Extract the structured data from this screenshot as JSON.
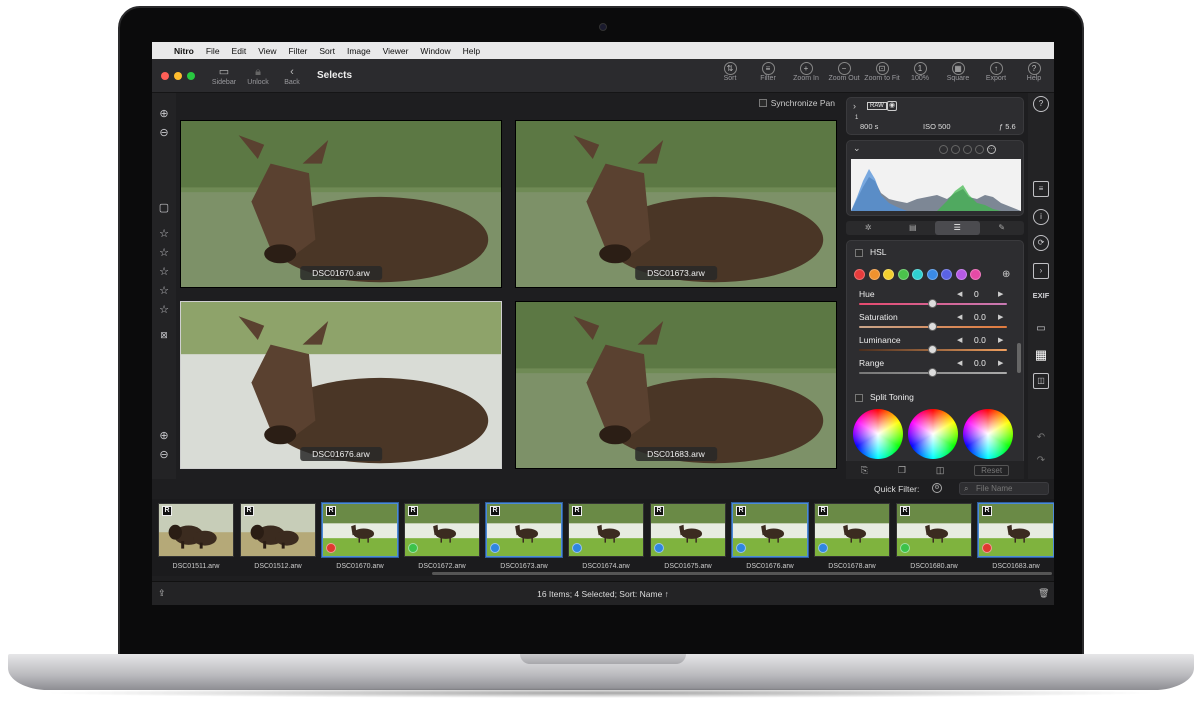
{
  "menu": {
    "app": "Nitro",
    "items": [
      "File",
      "Edit",
      "View",
      "Filter",
      "Sort",
      "Image",
      "Viewer",
      "Window",
      "Help"
    ]
  },
  "toolbar": {
    "sidebar_label": "Sidebar",
    "unlock_label": "Unlock",
    "back_label": "Back",
    "title": "Selects",
    "right": [
      {
        "label": "Sort",
        "icon": "sort-icon",
        "glyph": "⇅"
      },
      {
        "label": "Filter",
        "icon": "filter-icon",
        "glyph": "≡"
      },
      {
        "label": "Zoom In",
        "icon": "zoom-in-icon",
        "glyph": "+"
      },
      {
        "label": "Zoom Out",
        "icon": "zoom-out-icon",
        "glyph": "−"
      },
      {
        "label": "Zoom to Fit",
        "icon": "zoom-fit-icon",
        "glyph": "⊡"
      },
      {
        "label": "100%",
        "icon": "zoom-100-icon",
        "glyph": "1"
      },
      {
        "label": "Square",
        "icon": "square-grid-icon",
        "glyph": "▦"
      },
      {
        "label": "Export",
        "icon": "export-icon",
        "glyph": "↑"
      },
      {
        "label": "Help",
        "icon": "help-icon",
        "glyph": "?"
      }
    ]
  },
  "viewer": {
    "sync_label": "Synchronize Pan",
    "photos": [
      {
        "name": "DSC01670.arw",
        "selected": false
      },
      {
        "name": "DSC01673.arw",
        "selected": false
      },
      {
        "name": "DSC01676.arw",
        "selected": true
      },
      {
        "name": "DSC01683.arw",
        "selected": false
      }
    ]
  },
  "exif": {
    "badge_raw": "RAW",
    "shutter_num": "1",
    "shutter_den": "800 s",
    "iso": "ISO 500",
    "aperture": "ƒ 5.6"
  },
  "hsl": {
    "title": "HSL",
    "swatches": [
      "#e63c3c",
      "#f0922e",
      "#f2d02f",
      "#4bc24b",
      "#2fd0d0",
      "#3a8ae6",
      "#5a62e6",
      "#b65ae6",
      "#e64aa6"
    ],
    "sliders": [
      {
        "label": "Hue",
        "value": "0"
      },
      {
        "label": "Saturation",
        "value": "0.0"
      },
      {
        "label": "Luminance",
        "value": "0.0"
      },
      {
        "label": "Range",
        "value": "0.0"
      }
    ]
  },
  "split_toning": {
    "title": "Split Toning"
  },
  "panel_bottom": {
    "reset_label": "Reset"
  },
  "right_bar": {
    "exif_label": "EXIF"
  },
  "quick_filter": {
    "label": "Quick Filter:",
    "placeholder": "File Name"
  },
  "filmstrip": [
    {
      "name": "DSC01511.arw",
      "subject": "bison",
      "raw": true,
      "dot": null,
      "selected": false
    },
    {
      "name": "DSC01512.arw",
      "subject": "bison",
      "raw": true,
      "dot": null,
      "selected": false
    },
    {
      "name": "DSC01670.arw",
      "subject": "moose",
      "raw": true,
      "dot": "#e0392f",
      "selected": true
    },
    {
      "name": "DSC01672.arw",
      "subject": "moose",
      "raw": true,
      "dot": "#3cc24a",
      "selected": false
    },
    {
      "name": "DSC01673.arw",
      "subject": "moose",
      "raw": true,
      "dot": "#2f86e0",
      "selected": true
    },
    {
      "name": "DSC01674.arw",
      "subject": "moose",
      "raw": true,
      "dot": "#2f86e0",
      "selected": false
    },
    {
      "name": "DSC01675.arw",
      "subject": "moose",
      "raw": true,
      "dot": "#2f86e0",
      "selected": false
    },
    {
      "name": "DSC01676.arw",
      "subject": "moose",
      "raw": true,
      "dot": "#2f86e0",
      "selected": true
    },
    {
      "name": "DSC01678.arw",
      "subject": "moose",
      "raw": true,
      "dot": "#2f86e0",
      "selected": false
    },
    {
      "name": "DSC01680.arw",
      "subject": "moose",
      "raw": true,
      "dot": "#3cc24a",
      "selected": false
    },
    {
      "name": "DSC01683.arw",
      "subject": "moose",
      "raw": true,
      "dot": "#e0392f",
      "selected": true
    }
  ],
  "status": {
    "text": "16 Items; 4 Selected; Sort: Name ↑"
  }
}
